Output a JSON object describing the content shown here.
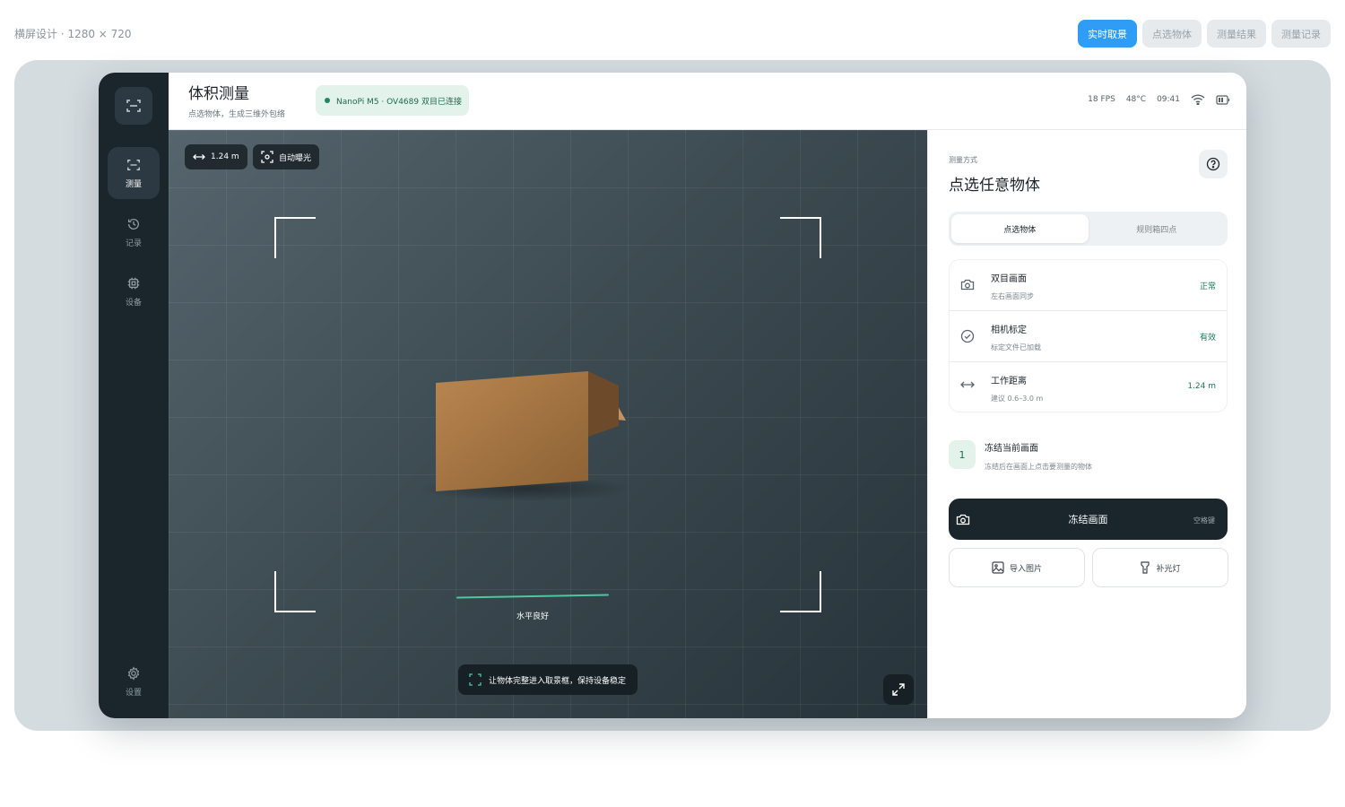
{
  "design_label": "横屏设计 · 1280 × 720",
  "top_tabs": [
    {
      "label": "实时取景",
      "active": true
    },
    {
      "label": "点选物体",
      "active": false
    },
    {
      "label": "测量结果",
      "active": false
    },
    {
      "label": "测量记录",
      "active": false
    }
  ],
  "rail": {
    "items": [
      {
        "label": "测量",
        "icon": "scan-icon",
        "active": true
      },
      {
        "label": "记录",
        "icon": "history-icon",
        "active": false
      },
      {
        "label": "设备",
        "icon": "chip-icon",
        "active": false
      }
    ],
    "settings_label": "设置"
  },
  "header": {
    "title": "体积测量",
    "subtitle": "点选物体，生成三维外包络",
    "connection": "NanoPi M5 · OV4689 双目已连接",
    "fps": "18 FPS",
    "temp": "48°C",
    "time": "09:41"
  },
  "viewport": {
    "distance_chip": "1.24 m",
    "exposure_chip": "自动曝光",
    "level_label": "水平良好",
    "hint": "让物体完整进入取景框，保持设备稳定"
  },
  "panel": {
    "mode_label": "测量方式",
    "mode_title": "点选任意物体",
    "segments": [
      {
        "label": "点选物体",
        "active": true
      },
      {
        "label": "规则箱四点",
        "active": false
      }
    ],
    "rows": [
      {
        "name": "双目画面",
        "desc": "左右画面同步",
        "value": "正常",
        "icon": "camera-icon"
      },
      {
        "name": "相机标定",
        "desc": "标定文件已加载",
        "value": "有效",
        "icon": "check-circle-icon"
      },
      {
        "name": "工作距离",
        "desc": "建议 0.6–3.0 m",
        "value": "1.24 m",
        "icon": "distance-icon"
      }
    ],
    "step": {
      "number": "1",
      "title": "冻结当前画面",
      "desc": "冻结后在画面上点击要测量的物体"
    },
    "freeze": {
      "label": "冻结画面",
      "shortcut": "空格键"
    },
    "import_label": "导入图片",
    "light_label": "补光灯"
  },
  "colors": {
    "accent": "#2f9cf5",
    "rail": "#1a252c",
    "success": "#1c7a55",
    "level": "#4cc7a0"
  }
}
